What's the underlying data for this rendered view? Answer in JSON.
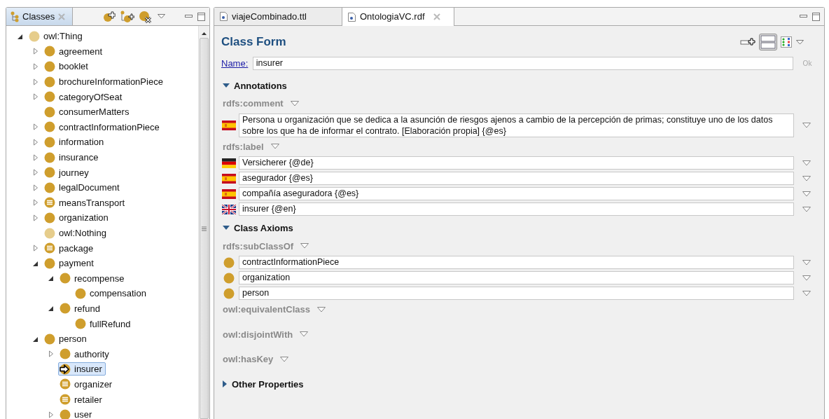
{
  "classes_view": {
    "title": "Classes",
    "tree": [
      {
        "label": "owl:Thing",
        "kind": "top",
        "expanded": true,
        "selected": false,
        "children": [
          {
            "label": "agreement",
            "kind": "class",
            "expanded": false,
            "selected": false
          },
          {
            "label": "booklet",
            "kind": "class",
            "expanded": false,
            "selected": false
          },
          {
            "label": "brochureInformationPiece",
            "kind": "class",
            "expanded": false,
            "selected": false
          },
          {
            "label": "categoryOfSeat",
            "kind": "class",
            "expanded": false,
            "selected": false
          },
          {
            "label": "consumerMatters",
            "kind": "class",
            "selected": false
          },
          {
            "label": "contractInformationPiece",
            "kind": "class",
            "expanded": false,
            "selected": false
          },
          {
            "label": "information",
            "kind": "class",
            "expanded": false,
            "selected": false
          },
          {
            "label": "insurance",
            "kind": "class",
            "expanded": false,
            "selected": false
          },
          {
            "label": "journey",
            "kind": "class",
            "expanded": false,
            "selected": false
          },
          {
            "label": "legalDocument",
            "kind": "class",
            "expanded": false,
            "selected": false
          },
          {
            "label": "meansTransport",
            "kind": "defined",
            "expanded": false,
            "selected": false
          },
          {
            "label": "organization",
            "kind": "class",
            "expanded": false,
            "selected": false
          },
          {
            "label": "owl:Nothing",
            "kind": "top",
            "selected": false
          },
          {
            "label": "package",
            "kind": "defined",
            "expanded": false,
            "selected": false
          },
          {
            "label": "payment",
            "kind": "class",
            "expanded": true,
            "selected": false,
            "children": [
              {
                "label": "recompense",
                "kind": "class",
                "expanded": true,
                "selected": false,
                "children": [
                  {
                    "label": "compensation",
                    "kind": "class",
                    "selected": false
                  }
                ]
              },
              {
                "label": "refund",
                "kind": "class",
                "expanded": true,
                "selected": false,
                "children": [
                  {
                    "label": "fullRefund",
                    "kind": "class",
                    "selected": false
                  }
                ]
              }
            ]
          },
          {
            "label": "person",
            "kind": "class",
            "expanded": true,
            "selected": false,
            "children": [
              {
                "label": "authority",
                "kind": "class",
                "expanded": false,
                "selected": false
              },
              {
                "label": "insurer",
                "kind": "current",
                "selected": true
              },
              {
                "label": "organizer",
                "kind": "defined",
                "selected": false
              },
              {
                "label": "retailer",
                "kind": "defined",
                "selected": false
              },
              {
                "label": "user",
                "kind": "class",
                "expanded": false,
                "selected": false
              }
            ]
          }
        ]
      }
    ]
  },
  "editor_tabs": [
    {
      "label": "viajeCombinado.ttl",
      "selected": false
    },
    {
      "label": "OntologiaVC.rdf",
      "selected": true
    }
  ],
  "class_form": {
    "title": "Class Form",
    "view_buttons": [
      {
        "kind": "add",
        "selected": false
      },
      {
        "kind": "form",
        "selected": true
      },
      {
        "kind": "grid",
        "selected": false
      }
    ],
    "name_label": "Name:",
    "name_value": "insurer",
    "ok_label": "Ok",
    "sections": [
      {
        "title": "Annotations",
        "expanded": true,
        "properties": [
          {
            "label": "rdfs:comment",
            "entries": [
              {
                "kind": "spanish",
                "text": "Persona u organización que se dedica a la asunción de riesgos ajenos a cambio de la percepción de primas; constituye uno de los datos sobre los que ha de informar el contrato. [Elaboración propia] {@es}"
              }
            ]
          },
          {
            "label": "rdfs:label",
            "entries": [
              {
                "kind": "german",
                "text": "Versicherer {@de}"
              },
              {
                "kind": "spanish",
                "text": "asegurador {@es}"
              },
              {
                "kind": "spanish",
                "text": "compañía aseguradora {@es}"
              },
              {
                "kind": "english",
                "text": "insurer {@en}"
              }
            ]
          }
        ]
      },
      {
        "title": "Class Axioms",
        "expanded": true,
        "properties": [
          {
            "label": "rdfs:subClassOf",
            "entries": [
              {
                "kind": "class",
                "text": "contractInformationPiece"
              },
              {
                "kind": "class",
                "text": "organization"
              },
              {
                "kind": "class",
                "text": "person"
              }
            ]
          },
          {
            "label": "owl:equivalentClass"
          },
          {
            "label": "owl:disjointWith"
          },
          {
            "label": "owl:hasKey"
          }
        ]
      },
      {
        "title": "Other Properties",
        "expanded": false
      }
    ]
  }
}
